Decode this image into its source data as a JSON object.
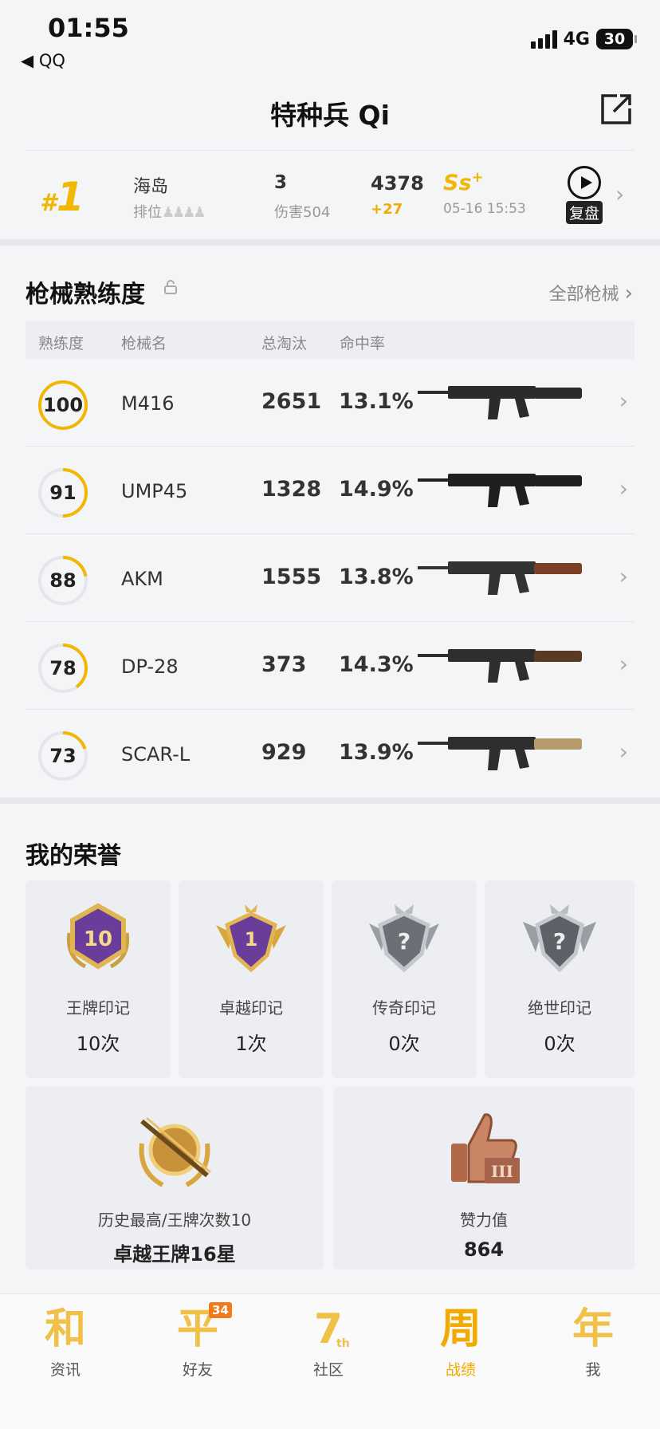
{
  "status": {
    "time": "01:55",
    "back": "◀ QQ",
    "network": "4G",
    "battery": "30"
  },
  "header": {
    "title": "特种兵 Qi"
  },
  "match": {
    "rank_num": "1",
    "rank_hash": "#",
    "map": "海岛",
    "rank_label": "排位",
    "kills": "3",
    "damage": "伤害504",
    "score": "4378",
    "score_delta": "+27",
    "grade": "Ss",
    "grade_plus": "+",
    "datetime": "05-16 15:53",
    "replay_label": "复盘"
  },
  "weapons": {
    "title": "枪械熟练度",
    "all_label": "全部枪械",
    "headers": {
      "mastery": "熟练度",
      "name": "枪械名",
      "kills": "总淘汰",
      "accuracy": "命中率"
    },
    "rows": [
      {
        "mastery": "100",
        "mastery_pct": 100,
        "name": "M416",
        "kills": "2651",
        "accuracy": "13.1%"
      },
      {
        "mastery": "91",
        "mastery_pct": 50,
        "name": "UMP45",
        "kills": "1328",
        "accuracy": "14.9%"
      },
      {
        "mastery": "88",
        "mastery_pct": 22,
        "name": "AKM",
        "kills": "1555",
        "accuracy": "13.8%"
      },
      {
        "mastery": "78",
        "mastery_pct": 40,
        "name": "DP-28",
        "kills": "373",
        "accuracy": "14.3%"
      },
      {
        "mastery": "73",
        "mastery_pct": 20,
        "name": "SCAR-L",
        "kills": "929",
        "accuracy": "13.9%"
      }
    ]
  },
  "honors": {
    "title": "我的荣誉",
    "cards": [
      {
        "label": "王牌印记",
        "value": "10次",
        "badge_text": "10"
      },
      {
        "label": "卓越印记",
        "value": "1次",
        "badge_text": "1"
      },
      {
        "label": "传奇印记",
        "value": "0次",
        "badge_text": "?"
      },
      {
        "label": "绝世印记",
        "value": "0次",
        "badge_text": "?"
      }
    ],
    "wide_cards": [
      {
        "label": "历史最高/王牌次数10",
        "value": "卓越王牌16星"
      },
      {
        "label": "赞力值",
        "value": "864"
      }
    ]
  },
  "tabs": [
    {
      "icon": "和",
      "label": "资讯"
    },
    {
      "icon": "平",
      "label": "好友",
      "badge": "34"
    },
    {
      "icon": "7",
      "sub": "th",
      "label": "社区"
    },
    {
      "icon": "周",
      "label": "战绩",
      "active": true
    },
    {
      "icon": "年",
      "label": "我"
    }
  ],
  "colors": {
    "accent": "#f2b705",
    "background": "#f3f5f7"
  }
}
